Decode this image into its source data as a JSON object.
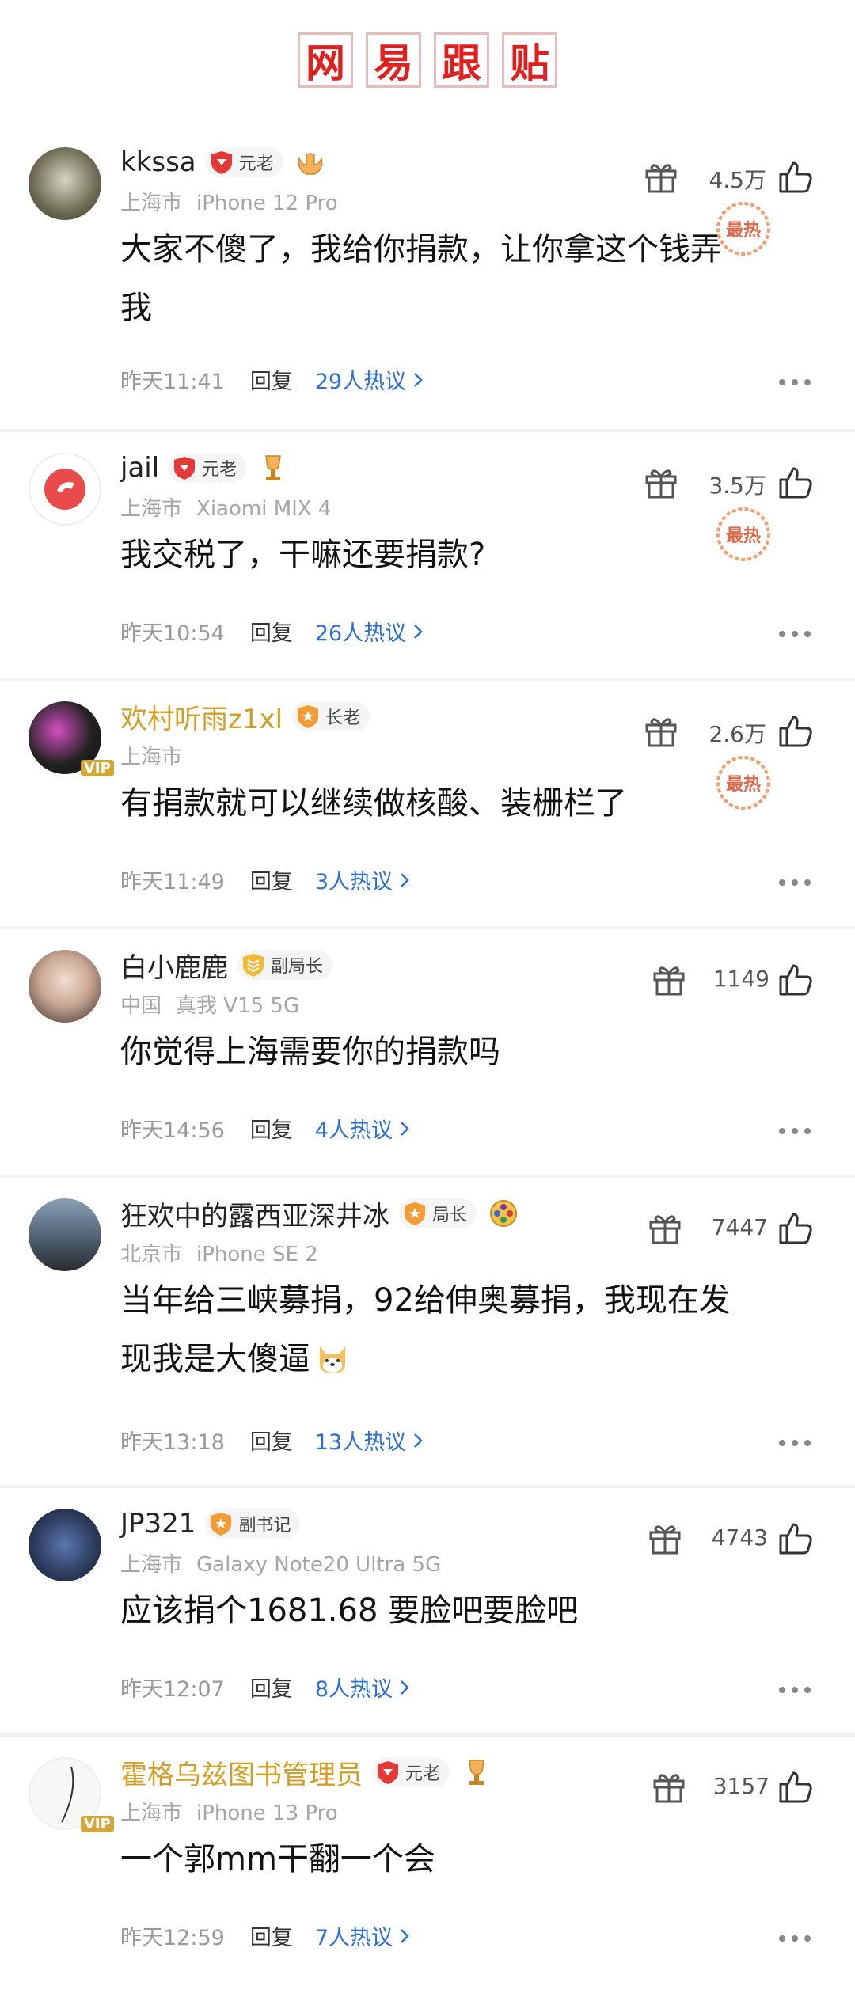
{
  "header": {
    "title_chars": [
      "网",
      "易",
      "跟",
      "贴"
    ]
  },
  "hot_stamp_label": "最热",
  "comments": [
    {
      "name": "kkssa",
      "name_gold": false,
      "badge": "元老",
      "badge_color": "#e53935",
      "location": "上海市",
      "device": "iPhone 12 Pro",
      "text_lines": [
        "大家不傻了，我给你捐款，让你拿这个钱弄",
        "我"
      ],
      "time": "昨天11:41",
      "reply": "回复",
      "hot": "29人热议",
      "likes": "4.5万",
      "hot_stamp": true,
      "avatar_color": "#6c6a52"
    },
    {
      "name": "jail",
      "name_gold": false,
      "badge": "元老",
      "badge_color": "#e53935",
      "location": "上海市",
      "device": "Xiaomi MIX 4",
      "text_lines": [
        "我交税了，干嘛还要捐款?"
      ],
      "time": "昨天10:54",
      "reply": "回复",
      "hot": "26人热议",
      "likes": "3.5万",
      "hot_stamp": true,
      "avatar_color": "#e94a4a"
    },
    {
      "name": "欢村听雨z1xl",
      "name_gold": true,
      "badge": "长老",
      "badge_color": "#f39c35",
      "location": "上海市",
      "device": "",
      "text_lines": [
        "有捐款就可以继续做核酸、装栅栏了"
      ],
      "time": "昨天11:49",
      "reply": "回复",
      "hot": "3人热议",
      "likes": "2.6万",
      "hot_stamp": true,
      "avatar_color": "#2a2a2a",
      "vip": true
    },
    {
      "name": "白小鹿鹿",
      "name_gold": false,
      "badge": "副局长",
      "badge_color": "#f2b935",
      "location": "中国",
      "device": "真我 V15 5G",
      "text_lines": [
        "你觉得上海需要你的捐款吗"
      ],
      "time": "昨天14:56",
      "reply": "回复",
      "hot": "4人热议",
      "likes": "1149",
      "hot_stamp": false,
      "avatar_color": "#c9a894"
    },
    {
      "name": "狂欢中的露西亚深井冰",
      "name_gold": false,
      "badge": "局长",
      "badge_color": "#f39c35",
      "location": "北京市",
      "device": "iPhone SE 2",
      "text_lines": [
        "当年给三峡募捐，92给伸奥募捐，我现在发",
        "现我是大傻逼"
      ],
      "time": "昨天13:18",
      "reply": "回复",
      "hot": "13人热议",
      "likes": "7447",
      "hot_stamp": false,
      "avatar_color": "#4a5a6a",
      "emoji": true
    },
    {
      "name": "JP321",
      "name_gold": false,
      "badge": "副书记",
      "badge_color": "#f39c35",
      "location": "上海市",
      "device": "Galaxy Note20 Ultra 5G",
      "text_lines": [
        "应该捐个1681.68 要脸吧要脸吧"
      ],
      "time": "昨天12:07",
      "reply": "回复",
      "hot": "8人热议",
      "likes": "4743",
      "hot_stamp": false,
      "avatar_color": "#2f3f62"
    },
    {
      "name": "霍格乌兹图书管理员",
      "name_gold": true,
      "badge": "元老",
      "badge_color": "#e53935",
      "location": "上海市",
      "device": "iPhone 13 Pro",
      "text_lines": [
        "一个郭mm干翻一个会"
      ],
      "time": "昨天12:59",
      "reply": "回复",
      "hot": "7人热议",
      "likes": "3157",
      "hot_stamp": false,
      "avatar_color": "#f4f4f4",
      "vip": true
    }
  ]
}
